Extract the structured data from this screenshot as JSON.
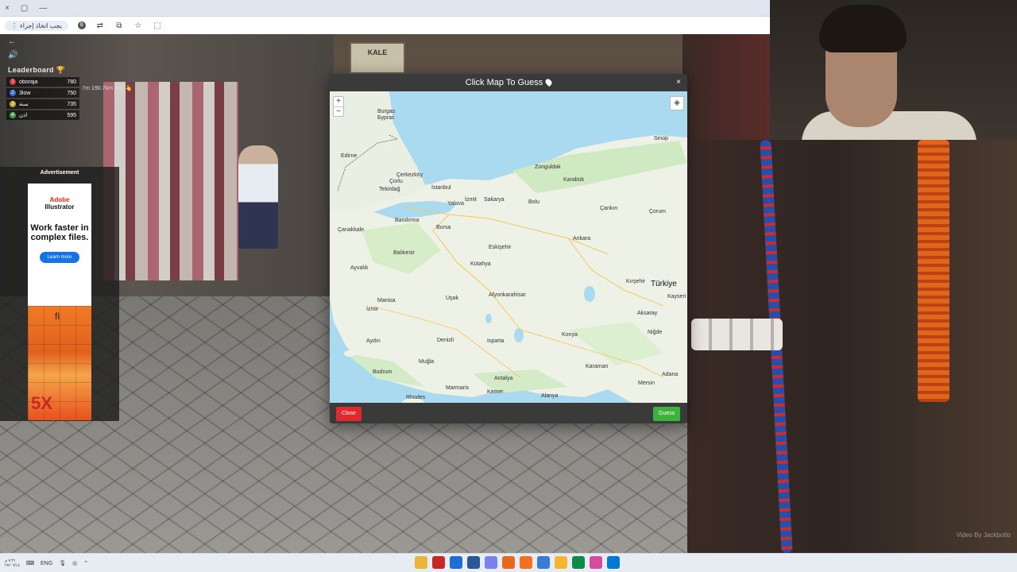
{
  "browser": {
    "window_controls": [
      "×",
      "▢",
      "—"
    ],
    "address_text": "يجب اتخاذ إجراء",
    "badge": "8"
  },
  "hud": {
    "leaderboard_title": "Leaderboard 🏆",
    "rows": [
      {
        "rank": "1",
        "name": "oboraja",
        "score": "780",
        "color": "#d63b3b"
      },
      {
        "rank": "2",
        "name": "3low",
        "score": "750",
        "color": "#3b6fd6"
      },
      {
        "rank": "3",
        "name": "سنة",
        "score": "735",
        "color": "#c9a227"
      },
      {
        "rank": "4",
        "name": "اذن",
        "score": "595",
        "color": "#3da34a"
      }
    ],
    "distance_text": "I'm 190.7km out. 👆"
  },
  "ad": {
    "label": "Advertisement",
    "brand_line1": "Adobe",
    "brand_line2": "Illustrator",
    "headline": "Work faster in complex files.",
    "cta": "Learn more",
    "art_glyph": "fi",
    "art_big": "5X"
  },
  "modal": {
    "title": "Click Map To Guess",
    "close_x": "×",
    "close_button": "Close",
    "guess_button": "Guess",
    "zoom_in": "+",
    "zoom_out": "−",
    "layers_icon": "◈"
  },
  "map": {
    "country_label": "Türkiye",
    "cities": [
      {
        "name": "Burgas",
        "key": "burgas"
      },
      {
        "name": "Бургас",
        "key": "burgas_cyr"
      },
      {
        "name": "Edirne",
        "key": "edirne"
      },
      {
        "name": "Çerkezköy",
        "key": "cerkezkoy"
      },
      {
        "name": "Çorlu",
        "key": "corlu"
      },
      {
        "name": "Tekirdağ",
        "key": "tekirdag"
      },
      {
        "name": "İstanbul",
        "key": "istanbul"
      },
      {
        "name": "İzmit",
        "key": "izmit"
      },
      {
        "name": "Sakarya",
        "key": "sakarya"
      },
      {
        "name": "Zonguldak",
        "key": "zonguldak"
      },
      {
        "name": "Karabük",
        "key": "karabuk"
      },
      {
        "name": "Bolu",
        "key": "bolu"
      },
      {
        "name": "Çankırı",
        "key": "cankiri"
      },
      {
        "name": "Çorum",
        "key": "corum"
      },
      {
        "name": "Sinop",
        "key": "sinop"
      },
      {
        "name": "Yalova",
        "key": "yalova"
      },
      {
        "name": "Bandırma",
        "key": "bandirma"
      },
      {
        "name": "Çanakkale",
        "key": "canakkale"
      },
      {
        "name": "Bursa",
        "key": "bursa"
      },
      {
        "name": "Eskişehir",
        "key": "eskisehir"
      },
      {
        "name": "Ankara",
        "key": "ankara"
      },
      {
        "name": "Balıkesir",
        "key": "balikesir"
      },
      {
        "name": "Kütahya",
        "key": "kutahya"
      },
      {
        "name": "Ayvalık",
        "key": "ayvalik"
      },
      {
        "name": "Manisa",
        "key": "manisa"
      },
      {
        "name": "Uşak",
        "key": "usak"
      },
      {
        "name": "Afyonkarahisar",
        "key": "afyon"
      },
      {
        "name": "Kırşehir",
        "key": "kirsehir"
      },
      {
        "name": "Kayseri",
        "key": "kayseri"
      },
      {
        "name": "İzmir",
        "key": "izmir"
      },
      {
        "name": "Aksaray",
        "key": "aksaray"
      },
      {
        "name": "Denizli",
        "key": "denizli"
      },
      {
        "name": "Isparta",
        "key": "isparta"
      },
      {
        "name": "Konya",
        "key": "konya"
      },
      {
        "name": "Niğde",
        "key": "nigde"
      },
      {
        "name": "Aydın",
        "key": "aydin"
      },
      {
        "name": "Muğla",
        "key": "mugla"
      },
      {
        "name": "Bodrum",
        "key": "bodrum"
      },
      {
        "name": "Karaman",
        "key": "karaman"
      },
      {
        "name": "Antalya",
        "key": "antalya"
      },
      {
        "name": "Adana",
        "key": "adana"
      },
      {
        "name": "Mersin",
        "key": "mersin"
      },
      {
        "name": "Rhodes",
        "key": "rhodes"
      },
      {
        "name": "Alanya",
        "key": "alanya"
      },
      {
        "name": "Kemer",
        "key": "kemer"
      },
      {
        "name": "Marmaris",
        "key": "marmaris"
      }
    ]
  },
  "scene": {
    "shop_sign": "KALE",
    "watermark": "Video By Jackbotto"
  },
  "taskbar": {
    "time": "٧:٣١ م",
    "date": "٢٧/٠٦/١٤",
    "lang": "ENG",
    "app_colors": [
      "#e9b53a",
      "#c62828",
      "#1f6fd1",
      "#2b5797",
      "#7b83eb",
      "#e36a1e",
      "#f36f21",
      "#3a7bd5",
      "#f2b632",
      "#0f8a4b",
      "#d44b9f",
      "#0078d4"
    ]
  },
  "colors": {
    "modal_bg": "#3a3a3a",
    "close_red": "#e0282d",
    "guess_green": "#3db23d",
    "sea": "#aadaef",
    "land": "#f2efe9"
  }
}
